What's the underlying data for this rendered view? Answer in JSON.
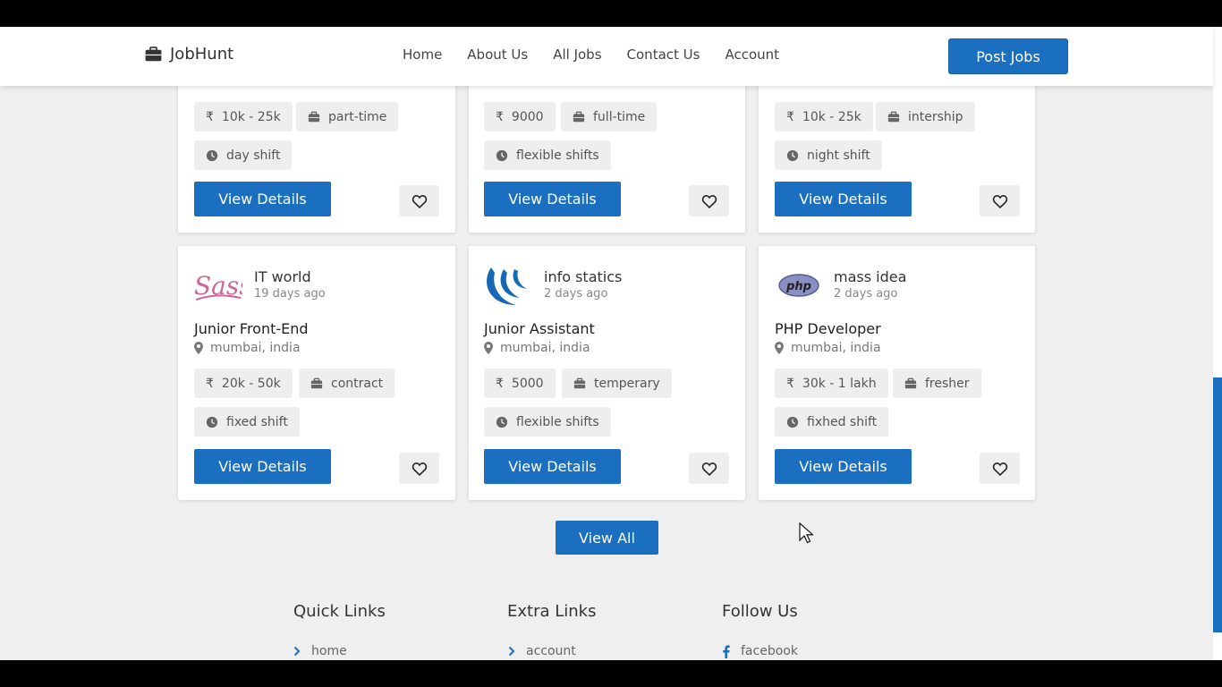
{
  "header": {
    "brand": "JobHunt",
    "nav": [
      "Home",
      "About Us",
      "All Jobs",
      "Contact Us",
      "Account"
    ],
    "post_button": "Post Jobs"
  },
  "jobs_top": [
    {
      "salary": "10k - 25k",
      "type": "part-time",
      "shift": "day shift"
    },
    {
      "salary": "9000",
      "type": "full-time",
      "shift": "flexible shifts"
    },
    {
      "salary": "10k - 25k",
      "type": "intership",
      "shift": "night shift"
    }
  ],
  "jobs": [
    {
      "company": "IT world",
      "posted": "19 days ago",
      "title": "Junior Front-End",
      "location": "mumbai, india",
      "salary": "20k - 50k",
      "type": "contract",
      "shift": "fixed shift",
      "logo": "sass-logo",
      "logo_text": "Sass"
    },
    {
      "company": "info statics",
      "posted": "2 days ago",
      "title": "Junior Assistant",
      "location": "mumbai, india",
      "salary": "5000",
      "type": "temperary",
      "shift": "flexible shifts",
      "logo": "jquery-logo"
    },
    {
      "company": "mass idea",
      "posted": "2 days ago",
      "title": "PHP Developer",
      "location": "mumbai, india",
      "salary": "30k - 1 lakh",
      "type": "fresher",
      "shift": "fixhed shift",
      "logo": "php-logo",
      "logo_text": "php"
    }
  ],
  "buttons": {
    "view_details": "View Details",
    "view_all": "View All"
  },
  "currency_symbol": "₹",
  "footer": {
    "quick_links": {
      "title": "Quick Links",
      "first": "home"
    },
    "extra_links": {
      "title": "Extra Links",
      "first": "account"
    },
    "follow_us": {
      "title": "Follow Us",
      "first": "facebook"
    }
  },
  "colors": {
    "primary": "#1b6fc0",
    "tag_bg": "#eeeeee",
    "page_bg": "#efefef"
  }
}
